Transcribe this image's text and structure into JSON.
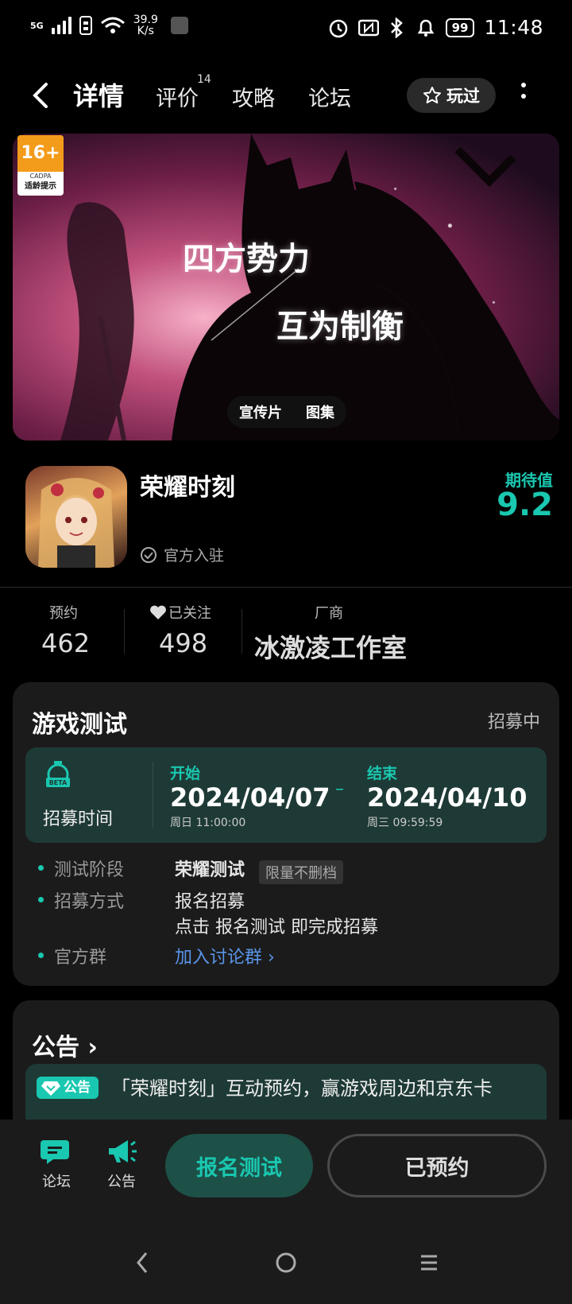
{
  "status_bar": {
    "network": "5G",
    "speed_value": "39.9",
    "speed_unit": "K/s",
    "battery": "99",
    "time": "11:48"
  },
  "nav": {
    "tabs": [
      {
        "label": "详情",
        "active": true
      },
      {
        "label": "评价",
        "badge": "14"
      },
      {
        "label": "攻略"
      },
      {
        "label": "论坛"
      }
    ],
    "played_label": "玩过"
  },
  "banner": {
    "slogan_line1": "四方势力",
    "slogan_line2": "互为制衡",
    "age_rating": "16+",
    "age_org": "CADPA",
    "age_note": "适龄提示",
    "media_tabs": [
      "宣传片",
      "图集"
    ]
  },
  "game": {
    "title": "荣耀时刻",
    "verified_label": "官方入驻",
    "expectation_label": "期待值",
    "expectation_value": "9.2"
  },
  "stats": [
    {
      "label": "预约",
      "value": "462"
    },
    {
      "label": "已关注",
      "value": "498"
    },
    {
      "label": "厂商",
      "value": "冰激凌工作室"
    }
  ],
  "test": {
    "title": "游戏测试",
    "status": "招募中",
    "time_label": "招募时间",
    "start_head": "开始",
    "start_date": "2024/04/07",
    "start_sub": "周日  11:00:00",
    "end_head": "结束",
    "end_date": "2024/04/10",
    "end_sub": "周三   09:59:59",
    "dash": "–",
    "rows": [
      {
        "key": "测试阶段",
        "value": "荣耀测试",
        "tag": "限量不删档"
      },
      {
        "key": "招募方式",
        "value": "报名招募",
        "value2": "点击 报名测试 即完成招募"
      },
      {
        "key": "官方群",
        "value": "加入讨论群 ›"
      }
    ]
  },
  "notice": {
    "title": "公告 ›",
    "tag": "公告",
    "text": "「荣耀时刻」互动预约，赢游戏周边和京东卡"
  },
  "bottom_bar": {
    "forum_label": "论坛",
    "notice_label": "公告",
    "test_button": "报名测试",
    "reserved_button": "已预约"
  },
  "colors": {
    "accent": "#1ac7b0",
    "link": "#5a95e8",
    "card": "#1b1b1b"
  }
}
